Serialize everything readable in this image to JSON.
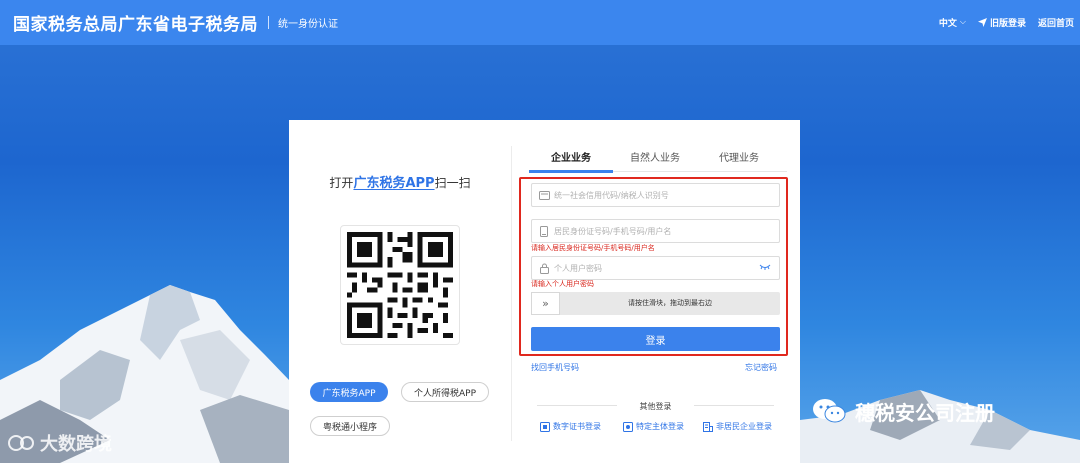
{
  "header": {
    "title": "国家税务总局广东省电子税务局",
    "subtitle": "统一身份认证",
    "language": "中文",
    "old_login": "旧版登录",
    "home": "返回首页"
  },
  "scan": {
    "prefix": "打开",
    "app": "广东税务APP",
    "suffix": "扫一扫"
  },
  "app_buttons": {
    "guangdong": "广东税务APP",
    "personal_tax": "个人所得税APP",
    "mini_program": "粤税通小程序"
  },
  "tabs": [
    "企业业务",
    "自然人业务",
    "代理业务"
  ],
  "form": {
    "credit_code_placeholder": "统一社会信用代码/纳税人识别号",
    "id_placeholder": "居民身份证号码/手机号码/用户名",
    "id_error": "请输入居民身份证号码/手机号码/用户名",
    "password_placeholder": "个人用户密码",
    "password_error": "请输入个人用户密码",
    "slider_text": "请按住滑块，拖动到最右边",
    "login_button": "登录",
    "retrieve_phone": "找回手机号码",
    "forgot_password": "忘记密码"
  },
  "other_login": {
    "title": "其他登录",
    "items": [
      "数字证书登录",
      "特定主体登录",
      "非居民企业登录"
    ]
  },
  "watermarks": {
    "left": "大数跨境",
    "right": "穗税安公司注册"
  },
  "colors": {
    "header": "#3b86ee",
    "accent": "#3b82ec",
    "error": "#d9261c",
    "highlight_frame": "#e0281e"
  }
}
